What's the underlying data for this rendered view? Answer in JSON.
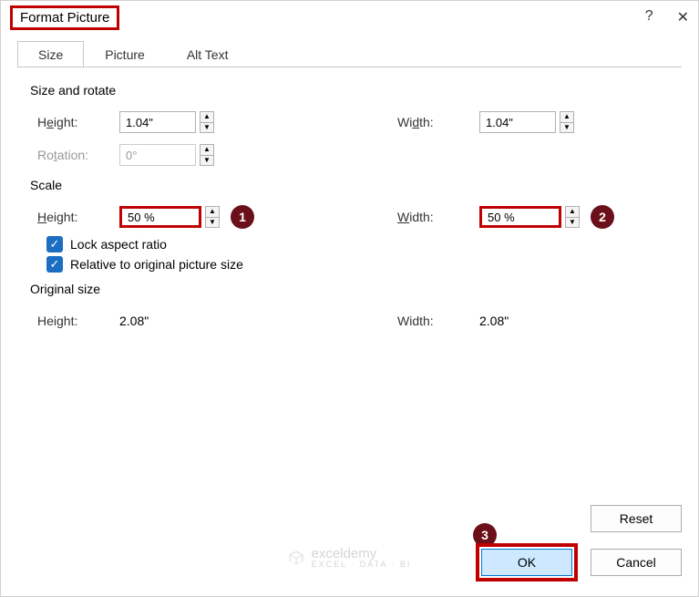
{
  "titlebar": {
    "title": "Format Picture",
    "help": "?",
    "close": "✕"
  },
  "tabs": {
    "size": "Size",
    "picture": "Picture",
    "alt": "Alt Text"
  },
  "section": {
    "sizeRotate": "Size and rotate",
    "scale": "Scale",
    "original": "Original size"
  },
  "labels": {
    "height": "Height:",
    "width": "Width:",
    "rotation": "Rotation:",
    "heightU": "Height:",
    "widthU": "Width:"
  },
  "sizeRotate": {
    "height": "1.04\"",
    "width": "1.04\"",
    "rotation": "0°"
  },
  "scale": {
    "height": "50 %",
    "width": "50 %"
  },
  "checks": {
    "lock": "Lock aspect ratio",
    "relative": "Relative to original picture size"
  },
  "original": {
    "height": "2.08\"",
    "width": "2.08\""
  },
  "buttons": {
    "reset": "Reset",
    "ok": "OK",
    "cancel": "Cancel"
  },
  "badges": {
    "one": "1",
    "two": "2",
    "three": "3"
  },
  "watermark": {
    "main": "exceldemy",
    "sub": "EXCEL · DATA · BI"
  }
}
